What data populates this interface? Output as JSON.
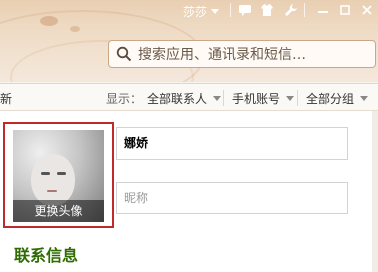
{
  "titlebar": {
    "username": "莎莎",
    "icons": [
      "comment-icon",
      "shirt-icon",
      "wrench-icon",
      "minimize-icon",
      "maximize-icon",
      "close-icon"
    ]
  },
  "search": {
    "placeholder": "搜索应用、通讯录和短信…",
    "icon": "search-icon"
  },
  "filterbar": {
    "left_label": "新",
    "display_label": "显示：",
    "filters": [
      "全部联系人",
      "手机账号",
      "全部分组"
    ]
  },
  "profile": {
    "change_avatar_label": "更换头像",
    "name_value": "娜娇",
    "nickname_placeholder": "昵称"
  },
  "section": {
    "contact_info_title": "联系信息"
  },
  "colors": {
    "title_gradient": "#e9cfb2",
    "avatar_border": "#c0282a",
    "section_title": "#2e6b00"
  }
}
